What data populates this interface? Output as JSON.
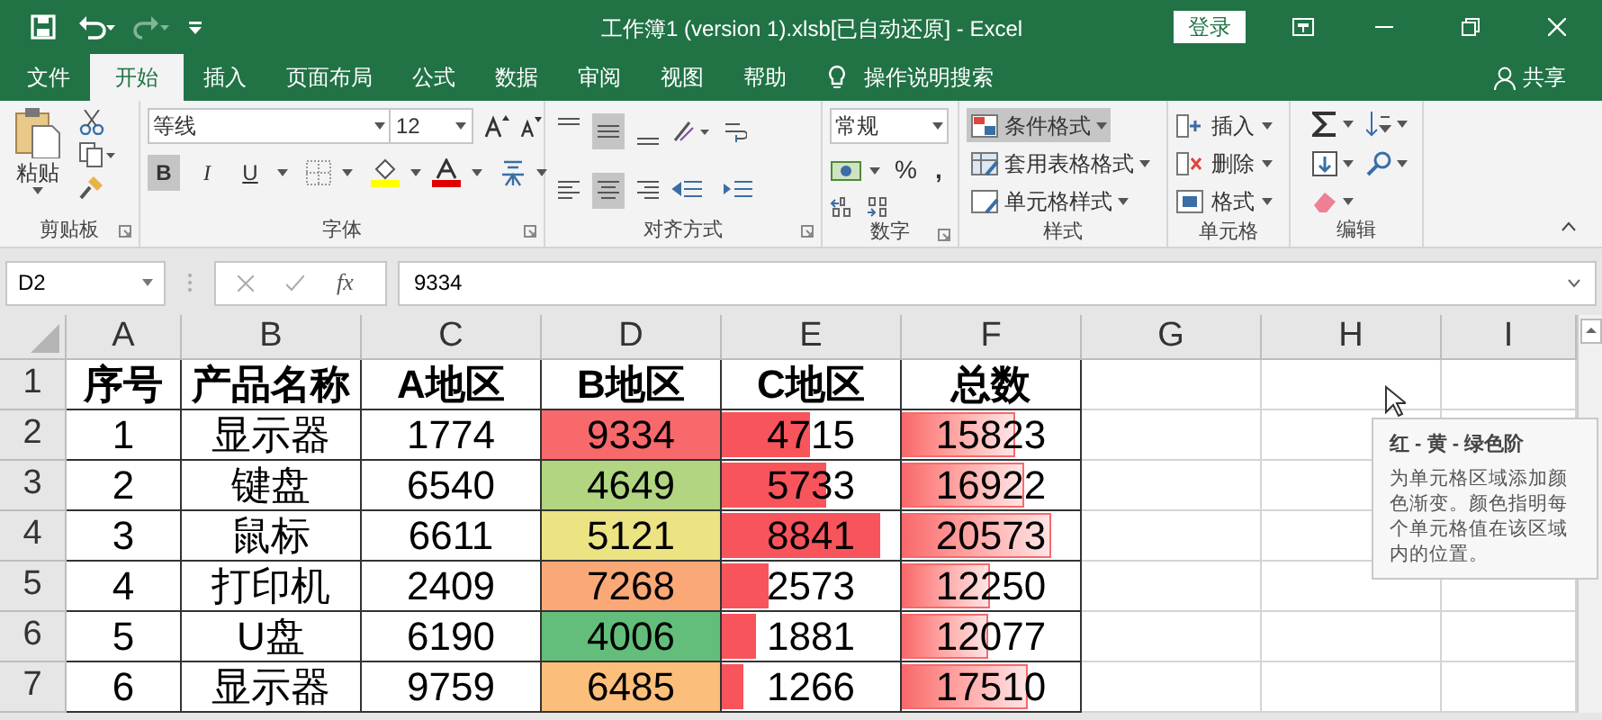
{
  "title_bar": {
    "title": "工作簿1 (version 1).xlsb[已自动还原]  -  Excel",
    "sign_in": "登录"
  },
  "menu_tabs": [
    {
      "label": "文件",
      "selected": false
    },
    {
      "label": "开始",
      "selected": true
    },
    {
      "label": "插入",
      "selected": false
    },
    {
      "label": "页面布局",
      "selected": false
    },
    {
      "label": "公式",
      "selected": false
    },
    {
      "label": "数据",
      "selected": false
    },
    {
      "label": "审阅",
      "selected": false
    },
    {
      "label": "视图",
      "selected": false
    },
    {
      "label": "帮助",
      "selected": false
    }
  ],
  "tell_me": "操作说明搜索",
  "share": "共享",
  "ribbon": {
    "clipboard": {
      "paste": "粘贴",
      "label": "剪贴板"
    },
    "font": {
      "font_name": "等线",
      "font_size": "12",
      "label": "字体",
      "format_buttons": [
        {
          "label": "B",
          "selected": true
        },
        {
          "label": "I",
          "selected": false
        },
        {
          "label": "U",
          "selected": false
        }
      ]
    },
    "alignment": {
      "label": "对齐方式",
      "buttons": [
        {
          "kind": "top",
          "selected": false
        },
        {
          "kind": "middle",
          "selected": true
        },
        {
          "kind": "bottom",
          "selected": false
        },
        {
          "kind": "left",
          "selected": false
        },
        {
          "kind": "center",
          "selected": true
        },
        {
          "kind": "right",
          "selected": false
        }
      ]
    },
    "number": {
      "format": "常规",
      "percent": "%",
      "comma": ",",
      "label": "数字"
    },
    "styles": {
      "label": "样式",
      "items": [
        {
          "label": "条件格式",
          "selected": true
        },
        {
          "label": "套用表格格式",
          "selected": false
        },
        {
          "label": "单元格样式",
          "selected": false
        }
      ]
    },
    "cells": {
      "label": "单元格",
      "items": [
        "插入",
        "删除",
        "格式"
      ]
    },
    "editing": {
      "label": "编辑"
    }
  },
  "formula_bar": {
    "name_box": "D2",
    "fx": "fx",
    "value": "9334"
  },
  "columns": [
    "A",
    "B",
    "C",
    "D",
    "E",
    "F",
    "G",
    "H",
    "I"
  ],
  "rows": [
    {
      "number": "1",
      "cells": [
        {
          "kind": "header",
          "text": "序号"
        },
        {
          "kind": "header",
          "text": "产品名称"
        },
        {
          "kind": "header",
          "text": "A地区"
        },
        {
          "kind": "header",
          "text": "B地区"
        },
        {
          "kind": "header",
          "text": "C地区"
        },
        {
          "kind": "header",
          "text": "总数"
        }
      ]
    },
    {
      "number": "2",
      "cells": [
        {
          "kind": "plain",
          "text": "1"
        },
        {
          "kind": "plain",
          "text": "显示器"
        },
        {
          "kind": "plain",
          "text": "1774"
        },
        {
          "kind": "color_scale",
          "text": "9334",
          "color": "#f8696b"
        },
        {
          "kind": "data_bar",
          "text": "4715",
          "level": 0.49
        },
        {
          "kind": "gradient_bar",
          "text": "15823",
          "level": 0.64
        }
      ]
    },
    {
      "number": "3",
      "cells": [
        {
          "kind": "plain",
          "text": "2"
        },
        {
          "kind": "plain",
          "text": "键盘"
        },
        {
          "kind": "plain",
          "text": "6540"
        },
        {
          "kind": "color_scale",
          "text": "4649",
          "color": "#b1d580"
        },
        {
          "kind": "data_bar",
          "text": "5733",
          "level": 0.59
        },
        {
          "kind": "gradient_bar",
          "text": "16922",
          "level": 0.69
        }
      ]
    },
    {
      "number": "4",
      "cells": [
        {
          "kind": "plain",
          "text": "3"
        },
        {
          "kind": "plain",
          "text": "鼠标"
        },
        {
          "kind": "plain",
          "text": "6611"
        },
        {
          "kind": "color_scale",
          "text": "5121",
          "color": "#ece382"
        },
        {
          "kind": "data_bar",
          "text": "8841",
          "level": 0.89
        },
        {
          "kind": "gradient_bar",
          "text": "20573",
          "level": 0.84
        }
      ]
    },
    {
      "number": "5",
      "cells": [
        {
          "kind": "plain",
          "text": "4"
        },
        {
          "kind": "plain",
          "text": "打印机"
        },
        {
          "kind": "plain",
          "text": "2409"
        },
        {
          "kind": "color_scale",
          "text": "7268",
          "color": "#fba877"
        },
        {
          "kind": "data_bar",
          "text": "2573",
          "level": 0.26
        },
        {
          "kind": "gradient_bar",
          "text": "12250",
          "level": 0.49
        }
      ]
    },
    {
      "number": "6",
      "cells": [
        {
          "kind": "plain",
          "text": "5"
        },
        {
          "kind": "plain",
          "text": "U盘"
        },
        {
          "kind": "plain",
          "text": "6190"
        },
        {
          "kind": "color_scale",
          "text": "4006",
          "color": "#63be7b"
        },
        {
          "kind": "data_bar",
          "text": "1881",
          "level": 0.19
        },
        {
          "kind": "gradient_bar",
          "text": "12077",
          "level": 0.48
        }
      ]
    },
    {
      "number": "7",
      "cells": [
        {
          "kind": "plain",
          "text": "6"
        },
        {
          "kind": "plain",
          "text": "显示器"
        },
        {
          "kind": "plain",
          "text": "9759"
        },
        {
          "kind": "color_scale",
          "text": "6485",
          "color": "#fcbf7b"
        },
        {
          "kind": "data_bar",
          "text": "1266",
          "level": 0.12
        },
        {
          "kind": "gradient_bar",
          "text": "17510",
          "level": 0.71
        }
      ]
    }
  ],
  "tooltip": {
    "title": "红 - 黄 - 绿色阶",
    "body": "为单元格区域添加颜色渐变。颜色指明每个单元格值在该区域内的位置。"
  }
}
